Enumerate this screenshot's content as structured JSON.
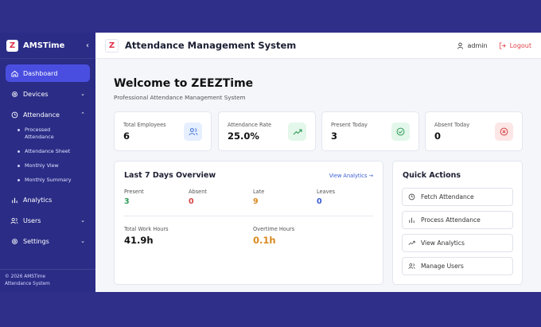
{
  "sidebar": {
    "brand": "AMSTime",
    "logo_letter": "Z",
    "items": [
      {
        "label": "Dashboard",
        "icon": "home-icon"
      },
      {
        "label": "Devices",
        "icon": "gear-icon"
      },
      {
        "label": "Attendance",
        "icon": "clock-icon"
      },
      {
        "label": "Analytics",
        "icon": "bar-chart-icon"
      },
      {
        "label": "Users",
        "icon": "users-icon"
      },
      {
        "label": "Settings",
        "icon": "gear-icon"
      }
    ],
    "attendance_sub": [
      "Processed Attendance",
      "Attendance Sheet",
      "Monthly View",
      "Monthly Summary"
    ],
    "footer_line1": "© 2026 AMSTime",
    "footer_line2": "Attendance System"
  },
  "header": {
    "title": "Attendance Management System",
    "logo_letter": "Z",
    "user": "admin",
    "logout": "Logout"
  },
  "main": {
    "welcome": "Welcome to ZEEZTime",
    "subtitle": "Professional Attendance Management System"
  },
  "stats": [
    {
      "label": "Total Employees",
      "value": "6",
      "icon": "users-icon",
      "color": "#3a6fd8",
      "bg": "#e6efff"
    },
    {
      "label": "Attendance Rate",
      "value": "25.0%",
      "icon": "trending-up-icon",
      "color": "#2f9b58",
      "bg": "#e3f7ea"
    },
    {
      "label": "Present Today",
      "value": "3",
      "icon": "check-circle-icon",
      "color": "#2f9b58",
      "bg": "#e3f7ea"
    },
    {
      "label": "Absent Today",
      "value": "0",
      "icon": "x-circle-icon",
      "color": "#d64545",
      "bg": "#fde6e6"
    }
  ],
  "overview": {
    "title": "Last 7 Days Overview",
    "link": "View Analytics →",
    "metrics": [
      {
        "label": "Present",
        "value": "3",
        "color": "#2f9b58"
      },
      {
        "label": "Absent",
        "value": "0",
        "color": "#d64545"
      },
      {
        "label": "Late",
        "value": "9",
        "color": "#d98a1f"
      },
      {
        "label": "Leaves",
        "value": "0",
        "color": "#3a5bd6"
      }
    ],
    "work_hours_label": "Total Work Hours",
    "work_hours_value": "41.9h",
    "overtime_label": "Overtime Hours",
    "overtime_value": "0.1h",
    "overtime_color": "#d98a1f"
  },
  "quick_actions": {
    "title": "Quick Actions",
    "buttons": [
      {
        "label": "Fetch Attendance",
        "icon": "clock-icon"
      },
      {
        "label": "Process Attendance",
        "icon": "bar-chart-icon"
      },
      {
        "label": "View Analytics",
        "icon": "trending-up-icon"
      },
      {
        "label": "Manage Users",
        "icon": "users-icon"
      }
    ]
  }
}
